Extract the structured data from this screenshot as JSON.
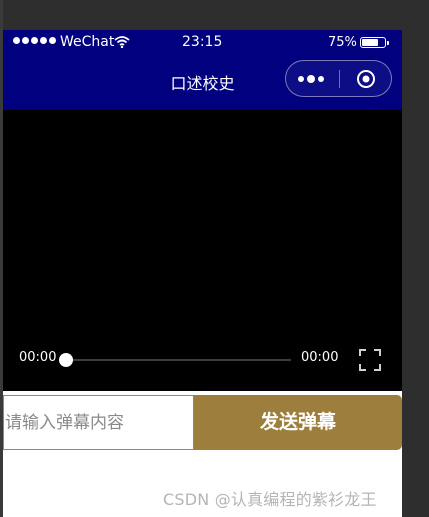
{
  "status_bar": {
    "carrier": "WeChat",
    "time": "23:15",
    "battery_percent": "75%",
    "battery_level": 0.75
  },
  "nav": {
    "title": "口述校史",
    "background_color": "#01007f",
    "more_icon": "more-dots-icon",
    "close_icon": "close-target-icon"
  },
  "video": {
    "current_time": "00:00",
    "duration": "00:00",
    "progress": 0,
    "fullscreen_icon": "fullscreen-icon"
  },
  "danmu": {
    "input_placeholder": "请输入弹幕内容",
    "input_value": "",
    "send_label": "发送弹幕",
    "accent_color": "#9d7e3c"
  },
  "watermark": "CSDN @认真编程的紫衫龙王"
}
